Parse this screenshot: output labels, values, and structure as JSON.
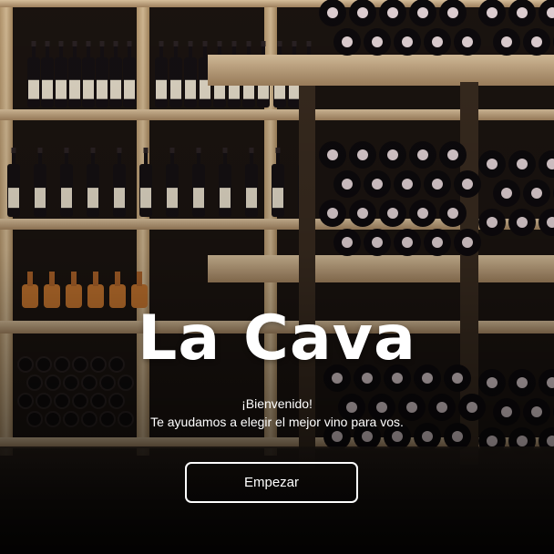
{
  "app": {
    "title": "La Cava",
    "welcome": "¡Bienvenido!",
    "subtitle": "Te ayudamos a elegir el mejor vino para vos.",
    "start_label": "Empezar"
  },
  "colors": {
    "text": "#ffffff",
    "button_border": "#ffffff",
    "wood": "#c8ab82",
    "shelf_interior": "#1a1310",
    "bottle": "#141014"
  },
  "background": {
    "scene": "wine-cellar-shelves-with-bottles"
  }
}
